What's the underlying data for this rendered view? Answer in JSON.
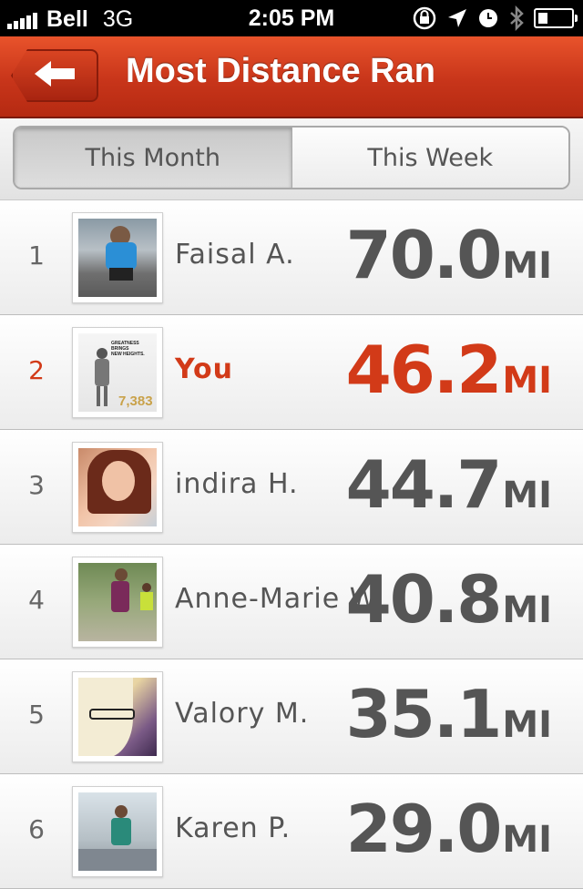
{
  "status_bar": {
    "carrier": "Bell",
    "network": "3G",
    "time": "2:05 PM",
    "battery_level": 0.3,
    "icons": [
      "signal-icon",
      "rotation-lock-icon",
      "location-icon",
      "alarm-icon",
      "bluetooth-icon",
      "battery-icon"
    ]
  },
  "header": {
    "title": "Most Distance Ran",
    "back_icon": "back-arrow-icon",
    "accent": "#c8351a"
  },
  "tabs": [
    {
      "label": "This Month",
      "selected": true
    },
    {
      "label": "This Week",
      "selected": false
    }
  ],
  "leaderboard": {
    "unit": "MI",
    "highlight_color": "#d23a18",
    "rows": [
      {
        "rank": "1",
        "name": "Faisal A.",
        "distance": "70.0",
        "is_user": false
      },
      {
        "rank": "2",
        "name": "You",
        "distance": "46.2",
        "is_user": true,
        "photo_text": {
          "line1": "GREATNESS BRINGS",
          "line2": "NEW HEIGHTS.",
          "number": "7,383"
        }
      },
      {
        "rank": "3",
        "name": "indira H.",
        "distance": "44.7",
        "is_user": false
      },
      {
        "rank": "4",
        "name": "Anne-Marie W.",
        "distance": "40.8",
        "is_user": false
      },
      {
        "rank": "5",
        "name": "Valory M.",
        "distance": "35.1",
        "is_user": false
      },
      {
        "rank": "6",
        "name": "Karen P.",
        "distance": "29.0",
        "is_user": false
      }
    ]
  }
}
